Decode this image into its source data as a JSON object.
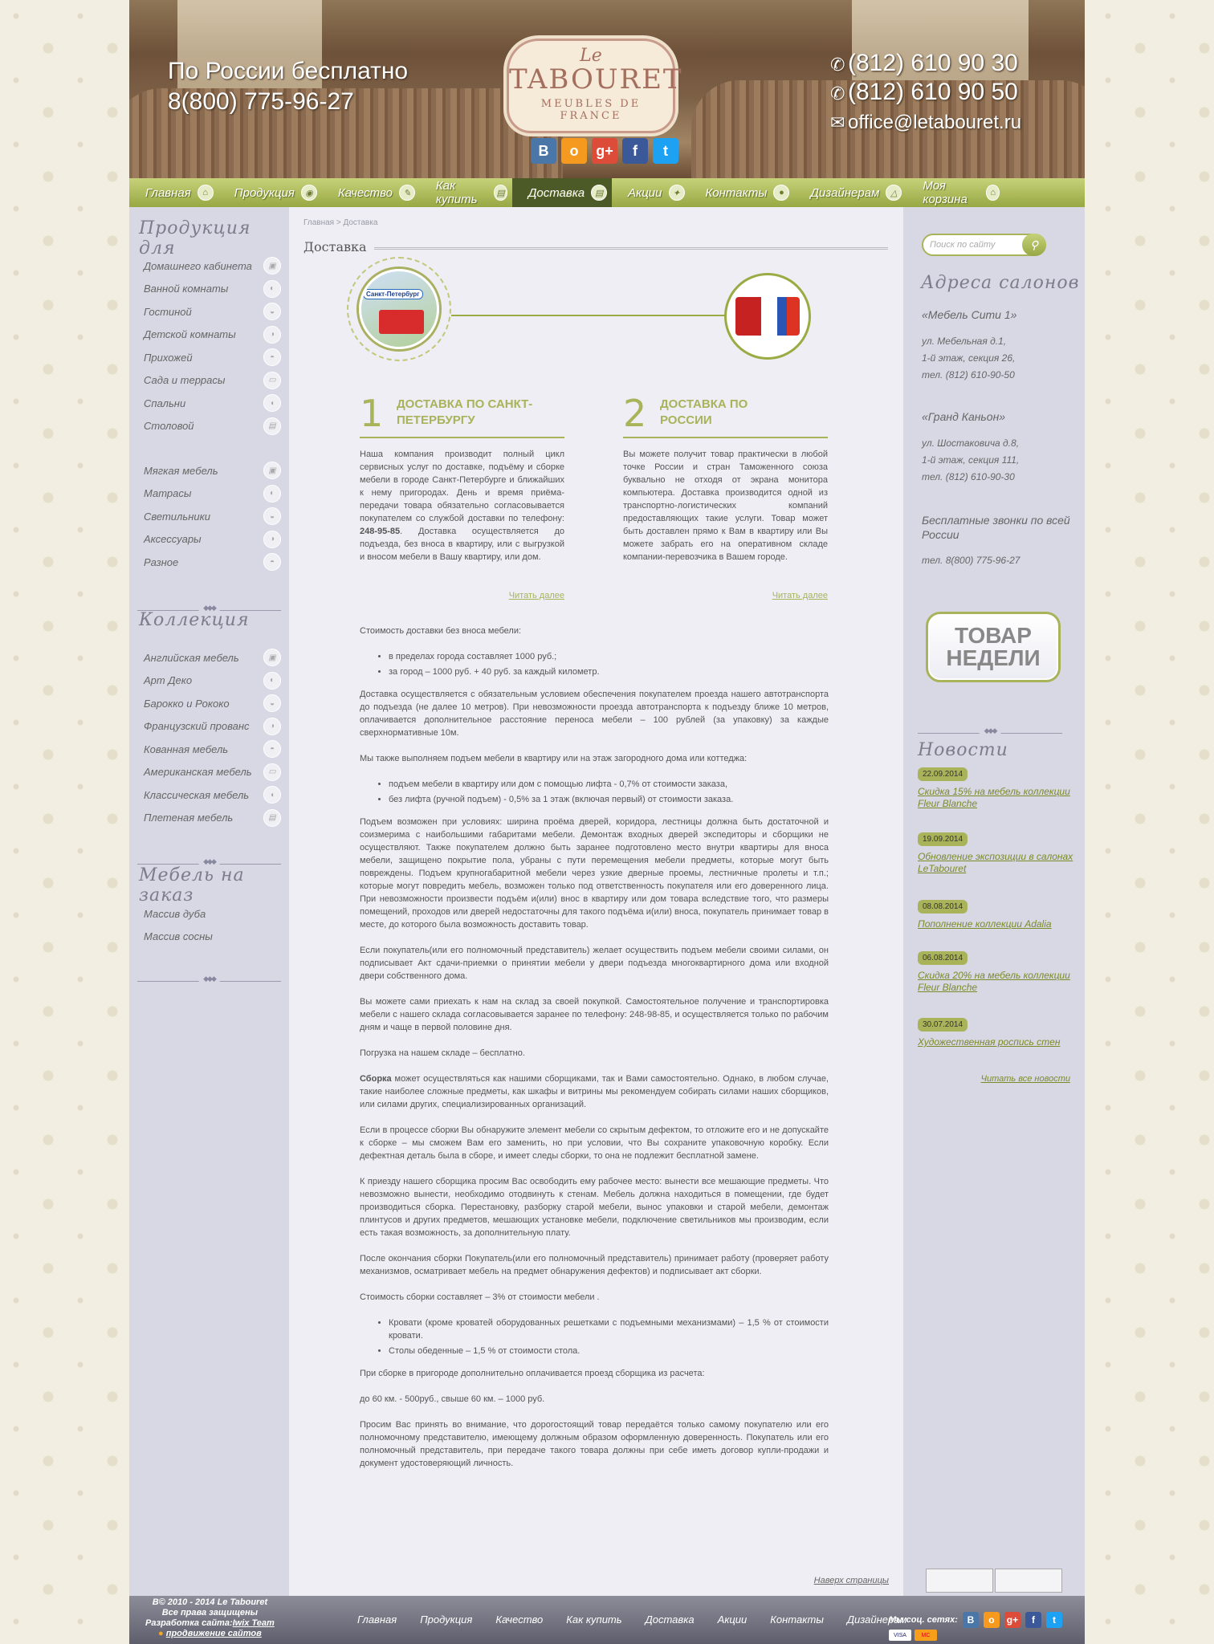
{
  "header": {
    "free_line1": "По России бесплатно",
    "free_line2": "8(800) 775-96-27",
    "logo": {
      "le": "Le",
      "name": "TABOURET",
      "sub": "MEUBLES DE FRANCE"
    },
    "phone1": "(812) 610 90 30",
    "phone2": "(812) 610 90 50",
    "email": "office@letabouret.ru",
    "social": [
      {
        "icon": "vk-icon",
        "glyph": "В",
        "color": "#4a76a8"
      },
      {
        "icon": "odnoklassniki-icon",
        "glyph": "о",
        "color": "#f59a1e"
      },
      {
        "icon": "google-plus-icon",
        "glyph": "g+",
        "color": "#dd4b39"
      },
      {
        "icon": "facebook-icon",
        "glyph": "f",
        "color": "#3b5998"
      },
      {
        "icon": "twitter-icon",
        "glyph": "t",
        "color": "#1da1f2"
      }
    ]
  },
  "nav": {
    "items": [
      "Главная",
      "Продукция",
      "Качество",
      "Как купить",
      "Доставка",
      "Акции",
      "Контакты",
      "Дизайнерам"
    ],
    "active": "Доставка",
    "cart": "Моя корзина"
  },
  "left": {
    "products_title": "Продукция для",
    "products": [
      "Домашнего кабинета",
      "Ванной комнаты",
      "Гостиной",
      "Детской комнаты",
      "Прихожей",
      "Сада и террасы",
      "Спальни",
      "Столовой"
    ],
    "categories": [
      "Мягкая мебель",
      "Матрасы",
      "Светильники",
      "Аксессуары",
      "Разное"
    ],
    "collection_title": "Коллекция",
    "collections": [
      "Английская мебель",
      "Арт Деко",
      "Барокко и Рококо",
      "Французский прованс",
      "Кованная мебель",
      "Американская мебель",
      "Классическая мебель",
      "Плетеная мебель"
    ],
    "custom_title": "Мебель на заказ",
    "custom": [
      "Массив дуба",
      "Массив сосны"
    ]
  },
  "main": {
    "breadcrumb": "Главная > Доставка",
    "title": "Доставка",
    "spb_label": "Санкт-Петербург",
    "step1": {
      "num": "1",
      "title": "Доставка по Санкт-Петербургу",
      "text_before": "Наша компания производит полный цикл сервисных услуг по доставке, подъёму и сборке мебели в городе Санкт-Петербурге и ближайших к нему пригородах. День и время приёма-передачи товара обязательно согласовывается покупателем со службой доставки по телефону: ",
      "phone": "248-95-85",
      "text_after": ". Доставка осуществляется до подъезда, без вноса в квартиру, или с выгрузкой и вносом мебели в Вашу квартиру, или дом.",
      "more": "Читать далее"
    },
    "step2": {
      "num": "2",
      "title": "Доставка по России",
      "text": "Вы можете получит товар практически в любой точке России и стран Таможенного союза буквально не отходя от экрана монитора компьютера. Доставка производится одной из транспортно-логистических компаний предоставляющих такие услуги. Товар может быть доставлен прямо к Вам в квартиру или Вы можете забрать его на оперативном складе компании-перевозчика в Вашем городе.",
      "more": "Читать далее"
    },
    "p1": "Стоимость доставки без вноса мебели:",
    "list1": [
      "в пределах города составляет 1000 руб.;",
      "за город – 1000 руб. + 40 руб. за каждый километр."
    ],
    "p2": "Доставка осуществляется с обязательным условием обеспечения покупателем проезда нашего автотранспорта до подъезда (не далее 10 метров). При невозможности проезда автотранспорта к подъезду ближе 10 метров, оплачивается дополнительное расстояние переноса мебели – 100 рублей (за упаковку) за каждые сверхнормативные 10м.",
    "p3": "Мы также выполняем подъем мебели в квартиру или на этаж загородного дома или коттеджа:",
    "list2": [
      "подъем мебели в квартиру или дом с помощью лифта - 0,7% от стоимости заказа,",
      "без лифта (ручной подъем) - 0,5% за 1 этаж (включая первый) от стоимости заказа."
    ],
    "p4": "Подъем возможен при условиях: ширина проёма дверей, коридора, лестницы должна быть достаточной и соизмерима с наибольшими габаритами мебели. Демонтаж входных дверей экспедиторы и сборщики не осуществляют. Также покупателем должно быть заранее подготовлено место внутри квартиры для вноса мебели, защищено покрытие пола, убраны с пути перемещения мебели предметы, которые могут быть повреждены. Подъем крупногабаритной мебели через узкие дверные проемы, лестничные пролеты и т.п.; которые могут повредить мебель, возможен только под ответственность покупателя или его доверенного лица. При невозможности произвести подъём и(или) внос в квартиру или дом товара вследствие того, что размеры помещений, проходов или дверей недостаточны для такого подъёма и(или) вноса, покупатель принимает товар в месте, до которого была возможность доставить товар.",
    "p5": "Если покупатель(или его полномочный представитель) желает осуществить подъем мебели своими силами, он подписывает Акт сдачи-приемки о принятии мебели у двери подъезда многоквартирного дома или входной двери собственного дома.",
    "p6": "Вы можете сами приехать к нам на склад за своей покупкой. Самостоятельное получение и транспортировка мебели с нашего склада согласовывается заранее по телефону: 248-98-85, и осуществляется только по рабочим дням и чаще в первой половине дня.",
    "p7": "Погрузка на нашем складе – бесплатно.",
    "p8_bold": "Сборка",
    "p8": " может осуществляться как нашими сборщиками, так и Вами самостоятельно. Однако, в любом случае, такие наиболее сложные предметы, как шкафы и витрины мы рекомендуем собирать силами наших сборщиков, или силами других, специализированных организаций.",
    "p9": "Если в процессе сборки Вы обнаружите элемент мебели со скрытым дефектом, то отложите его и не допускайте к сборке – мы сможем Вам его заменить, но при условии, что Вы сохраните упаковочную коробку. Если дефектная деталь была в сборе, и имеет следы сборки, то она не подлежит бесплатной замене.",
    "p10": "К приезду нашего сборщика просим Вас освободить ему рабочее место: вынести все мешающие предметы. Что невозможно вынести, необходимо отодвинуть к стенам. Мебель должна находиться в помещении, где будет производиться сборка. Перестановку, разборку старой мебели, вынос упаковки и старой мебели, демонтаж плинтусов и других предметов, мешающих установке мебели, подключение светильников мы производим, если есть такая возможность, за дополнительную плату.",
    "p11": "После окончания сборки Покупатель(или его полномочный представитель) принимает работу (проверяет работу механизмов, осматривает мебель на предмет обнаружения дефектов) и подписывает акт сборки.",
    "p12": "Стоимость сборки составляет – 3% от стоимости мебели .",
    "list3": [
      "Кровати (кроме кроватей оборудованных решетками с подъемными механизмами) – 1,5 % от стоимости кровати.",
      "Столы обеденные – 1,5 % от стоимости стола."
    ],
    "p13": "При сборке в пригороде дополнительно оплачивается проезд сборщика из расчета:",
    "p14": "до 60 км. - 500руб., свыше 60 км. – 1000 руб.",
    "p15": "Просим Вас принять во внимание, что дорогостоящий товар передаётся только самому покупателю или его полномочному представителю, имеющему должным образом оформленную доверенность. Покупатель или его полномочный представитель, при передаче такого товара должны при себе иметь договор купли-продажи и документ удостоверяющий личность.",
    "up_link": "Наверх страницы"
  },
  "right": {
    "search_placeholder": "Поиск по сайту",
    "addresses_title": "Адреса салонов",
    "salon1": {
      "name": "«Мебель Сити 1»",
      "l1": "ул. Мебельная д.1,",
      "l2": "1-й этаж, секция 26,",
      "l3": "тел. (812) 610-90-50"
    },
    "salon2": {
      "name": "«Гранд Каньон»",
      "l1": "ул. Шостаковича д.8,",
      "l2": "1-й этаж, секция 111,",
      "l3": "тел. (812) 610-90-30"
    },
    "free_calls": "Бесплатные звонки по всей России",
    "free_phone": "тел. 8(800) 775-96-27",
    "week_line1": "ТОВАР",
    "week_line2": "НЕДЕЛИ",
    "news_title": "Новости",
    "news": [
      {
        "date": "22.09.2014",
        "text": "Скидка 15% на мебель коллекции Fleur Blanche"
      },
      {
        "date": "19.09.2014",
        "text": "Обновление экспозиции в салонах LeTabouret"
      },
      {
        "date": "08.08.2014",
        "text": "Пополнение коллекции Adalia"
      },
      {
        "date": "06.08.2014",
        "text": "Скидка 20% на мебель коллекции Fleur Blanche"
      },
      {
        "date": "30.07.2014",
        "text": "Художественная роспись стен"
      }
    ],
    "all_news": "Читать все новости"
  },
  "footer": {
    "copy1": "В© 2010 - 2014 Le Tabouret",
    "copy2": "Все права защищены",
    "dev_label": "Разработка сайта:",
    "dev_name": "Iwix Team",
    "promo": "продвижение сайтов",
    "nav": [
      "Главная",
      "Продукция",
      "Качество",
      "Как купить",
      "Доставка",
      "Акции",
      "Контакты",
      "Дизайнерам"
    ],
    "social_label": "Мы соц. сетях:",
    "pay": [
      "VISA",
      "MC"
    ]
  }
}
